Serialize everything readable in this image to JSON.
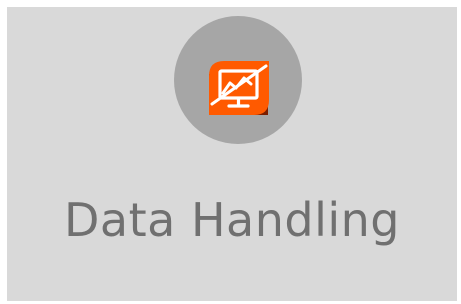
{
  "tile": {
    "title": "Data Handling",
    "icon": "monitor-chart-icon",
    "colors": {
      "background": "#d9d9d9",
      "circle": "#a6a6a6",
      "badge_accent": "#ff5a00",
      "badge_dark": "#7a1e00",
      "text": "#707070"
    }
  }
}
